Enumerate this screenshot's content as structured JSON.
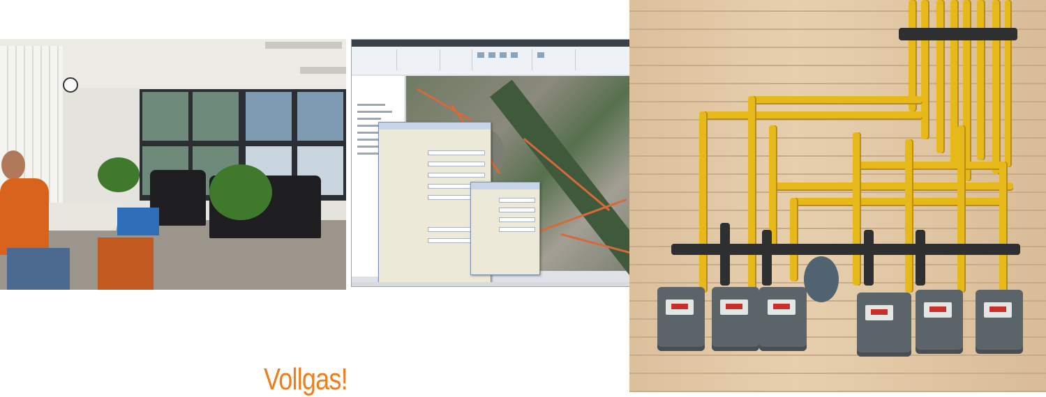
{
  "caption": {
    "text": "Vollgas!",
    "color": "#f07e1b"
  },
  "photos": [
    {
      "subject": "control-room"
    },
    {
      "subject": "gis-software-screenshot"
    },
    {
      "subject": "gas-meters-on-brick-wall"
    }
  ]
}
